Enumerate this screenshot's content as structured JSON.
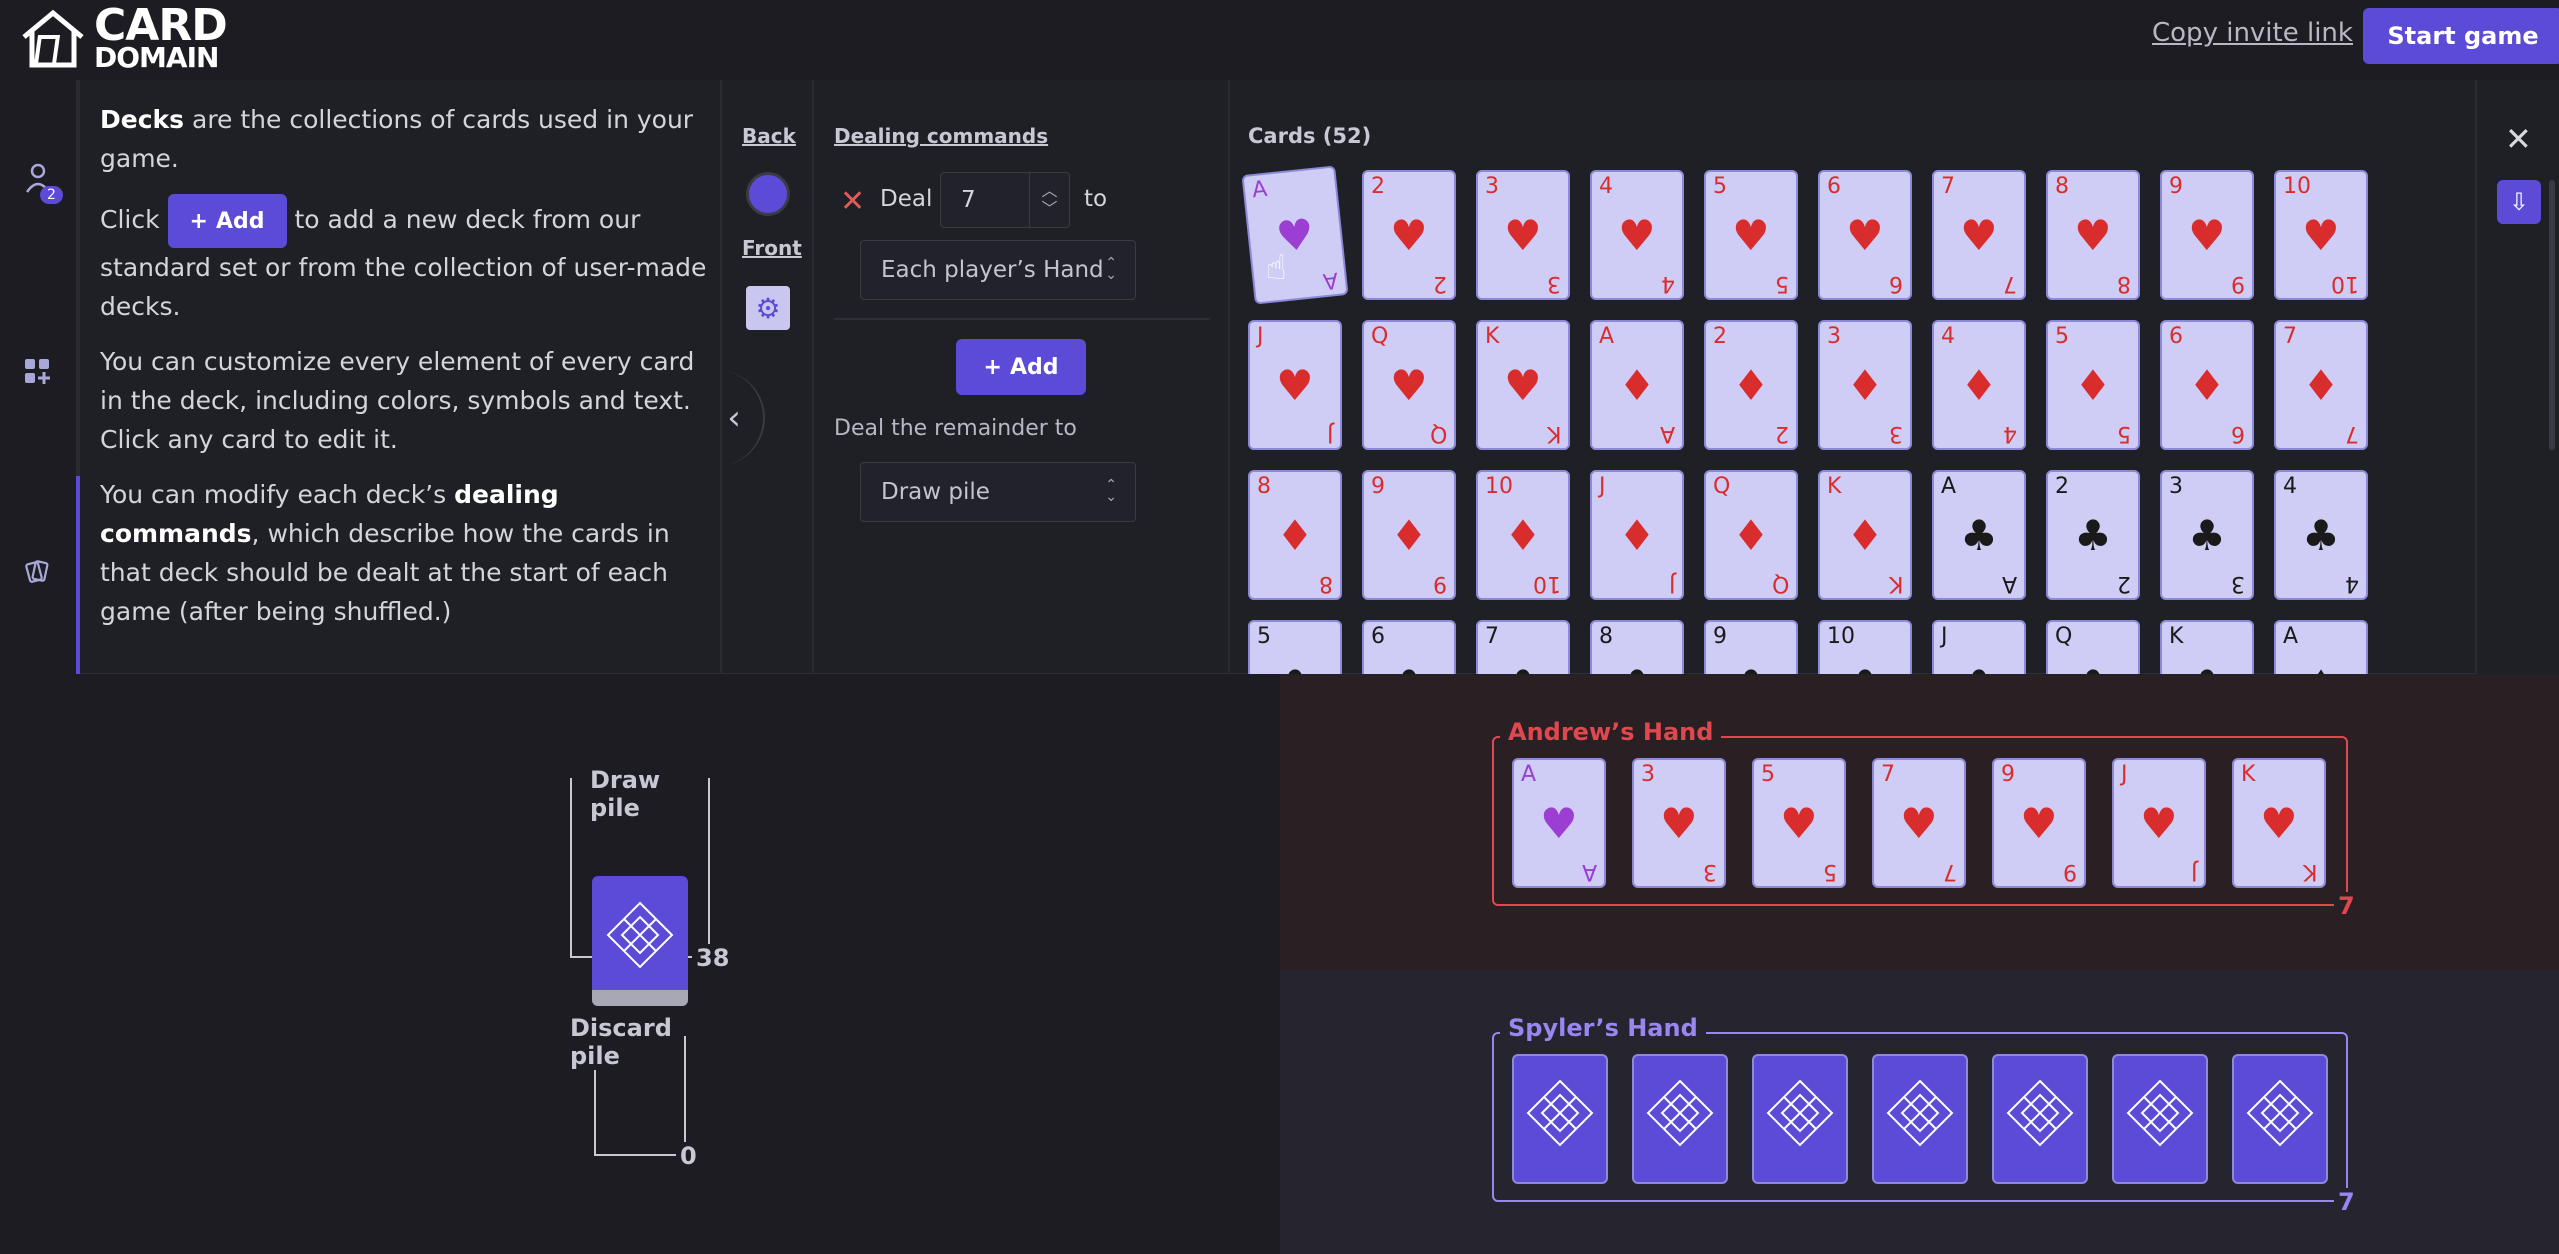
{
  "brand": {
    "line1": "CARD",
    "line2": "DOMAIN"
  },
  "topbar": {
    "invite_label": "Copy invite link",
    "start_label": "Start game"
  },
  "rail": {
    "players_badge": "2"
  },
  "help": {
    "p1_bold": "Decks",
    "p1_rest": " are the collections of cards used in your game.",
    "p2_pre": "Click ",
    "p2_button": "Add",
    "p2_post": " to add a new deck from our standard set or from the collection of user-made decks.",
    "p3": "You can customize every element of every card in the deck, including colors, symbols and text. Click any card to edit it.",
    "p4_pre": "You can modify each deck’s ",
    "p4_bold": "dealing commands",
    "p4_post": ", which describe how the cards in that deck should be dealt at the start of each game (after being shuffled.)"
  },
  "backfront": {
    "back_label": "Back",
    "front_label": "Front",
    "back_color": "#5b4bd6"
  },
  "dealing": {
    "title": "Dealing commands",
    "deal_label": "Deal",
    "deal_count": "7",
    "to_label": "to",
    "target": "Each player’s Hand",
    "add_label": "Add",
    "remainder_label": "Deal the remainder to",
    "remainder_target": "Draw pile"
  },
  "cards": {
    "title": "Cards (52)",
    "rows": [
      [
        {
          "r": "A",
          "s": "♥",
          "c": "purple"
        },
        {
          "r": "2",
          "s": "♥",
          "c": "red"
        },
        {
          "r": "3",
          "s": "♥",
          "c": "red"
        },
        {
          "r": "4",
          "s": "♥",
          "c": "red"
        },
        {
          "r": "5",
          "s": "♥",
          "c": "red"
        },
        {
          "r": "6",
          "s": "♥",
          "c": "red"
        },
        {
          "r": "7",
          "s": "♥",
          "c": "red"
        },
        {
          "r": "8",
          "s": "♥",
          "c": "red"
        },
        {
          "r": "9",
          "s": "♥",
          "c": "red"
        },
        {
          "r": "10",
          "s": "♥",
          "c": "red"
        }
      ],
      [
        {
          "r": "J",
          "s": "♥",
          "c": "red"
        },
        {
          "r": "Q",
          "s": "♥",
          "c": "red"
        },
        {
          "r": "K",
          "s": "♥",
          "c": "red"
        },
        {
          "r": "A",
          "s": "♦",
          "c": "red"
        },
        {
          "r": "2",
          "s": "♦",
          "c": "red"
        },
        {
          "r": "3",
          "s": "♦",
          "c": "red"
        },
        {
          "r": "4",
          "s": "♦",
          "c": "red"
        },
        {
          "r": "5",
          "s": "♦",
          "c": "red"
        },
        {
          "r": "6",
          "s": "♦",
          "c": "red"
        },
        {
          "r": "7",
          "s": "♦",
          "c": "red"
        }
      ],
      [
        {
          "r": "8",
          "s": "♦",
          "c": "red"
        },
        {
          "r": "9",
          "s": "♦",
          "c": "red"
        },
        {
          "r": "10",
          "s": "♦",
          "c": "red"
        },
        {
          "r": "J",
          "s": "♦",
          "c": "red"
        },
        {
          "r": "Q",
          "s": "♦",
          "c": "red"
        },
        {
          "r": "K",
          "s": "♦",
          "c": "red"
        },
        {
          "r": "A",
          "s": "♣",
          "c": "black"
        },
        {
          "r": "2",
          "s": "♣",
          "c": "black"
        },
        {
          "r": "3",
          "s": "♣",
          "c": "black"
        },
        {
          "r": "4",
          "s": "♣",
          "c": "black"
        }
      ],
      [
        {
          "r": "5",
          "s": "♣",
          "c": "black"
        },
        {
          "r": "6",
          "s": "♣",
          "c": "black"
        },
        {
          "r": "7",
          "s": "♣",
          "c": "black"
        },
        {
          "r": "8",
          "s": "♣",
          "c": "black"
        },
        {
          "r": "9",
          "s": "♣",
          "c": "black"
        },
        {
          "r": "10",
          "s": "♣",
          "c": "black"
        },
        {
          "r": "J",
          "s": "♣",
          "c": "black"
        },
        {
          "r": "Q",
          "s": "♣",
          "c": "black"
        },
        {
          "r": "K",
          "s": "♣",
          "c": "black"
        },
        {
          "r": "A",
          "s": "♠",
          "c": "black"
        }
      ]
    ]
  },
  "table": {
    "draw_pile": {
      "title": "Draw pile",
      "count": "38"
    },
    "discard_pile": {
      "title": "Discard pile",
      "count": "0"
    }
  },
  "hands": [
    {
      "title": "Andrew’s Hand",
      "count": "7",
      "accent": "#e0484f",
      "background": "#2a1f23",
      "face_up": true,
      "cards": [
        {
          "r": "A",
          "s": "♥",
          "c": "purple"
        },
        {
          "r": "3",
          "s": "♥",
          "c": "red"
        },
        {
          "r": "5",
          "s": "♥",
          "c": "red"
        },
        {
          "r": "7",
          "s": "♥",
          "c": "red"
        },
        {
          "r": "9",
          "s": "♥",
          "c": "red"
        },
        {
          "r": "J",
          "s": "♥",
          "c": "red"
        },
        {
          "r": "K",
          "s": "♥",
          "c": "red"
        }
      ]
    },
    {
      "title": "Spyler’s Hand",
      "count": "7",
      "accent": "#9a86f0",
      "background": "#25242f",
      "face_up": false,
      "cards": [
        {},
        {},
        {},
        {},
        {},
        {},
        {}
      ]
    }
  ],
  "icons": {
    "house": "house-logo-icon",
    "players": "players-icon",
    "add_widget": "add-widget-icon",
    "cards": "cards-icon",
    "gear": "gear-icon",
    "chevron_left": "chevron-left-icon",
    "close": "close-icon",
    "download": "download-icon"
  }
}
